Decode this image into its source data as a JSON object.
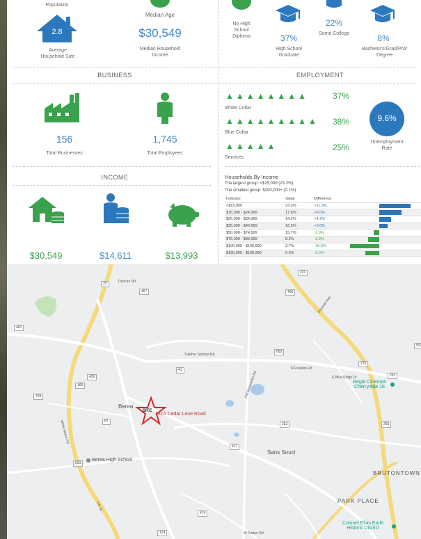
{
  "demographics": {
    "population_label": "Population",
    "avg_household_size_value": "2.8",
    "avg_household_size_label": "Average\nHousehold Size",
    "median_age_label": "Median Age",
    "median_household_income_value": "$30,549",
    "median_household_income_label": "Median Household\nIncome",
    "no_high_school_label": "No High\nSchool\nDiploma",
    "high_school_pct": "37%",
    "high_school_label": "High School\nGraduate",
    "some_college_pct": "22%",
    "some_college_label": "Some College",
    "bachelors_pct": "8%",
    "bachelors_label": "Bachelor's/Grad/Prof\nDegree"
  },
  "business": {
    "title": "BUSINESS",
    "total_businesses_value": "156",
    "total_businesses_label": "Total Businesses",
    "total_employees_value": "1,745",
    "total_employees_label": "Total Employees"
  },
  "employment": {
    "title": "EMPLOYMENT",
    "white_collar_pct": "37%",
    "white_collar_label": "White Collar",
    "blue_collar_pct": "38%",
    "blue_collar_label": "Blue Collar",
    "services_pct": "25%",
    "services_label": "Services",
    "unemployment_value": "9.6%",
    "unemployment_label": "Unemployment\nRate"
  },
  "income": {
    "title": "INCOME",
    "median_household_income": "$30,549",
    "per_capita_income": "$14,611",
    "median_net_worth": "$13,993"
  },
  "households_by_income": {
    "title": "Households By Income",
    "largest_group": "The largest group: <$15,000 (23.3%)",
    "smallest_group": "The smallest group: $200,000+ (0.1%)",
    "headers": [
      "Indicator",
      "Value",
      "Difference"
    ],
    "rows": [
      {
        "indicator": "<$15,000",
        "value": "23.3%",
        "difference": "+11.3%",
        "diff": 11.3
      },
      {
        "indicator": "$15,000 - $24,999",
        "value": "17.8%",
        "difference": "+8.0%",
        "diff": 8.0
      },
      {
        "indicator": "$25,000 - $34,999",
        "value": "14.2%",
        "difference": "+4.2%",
        "diff": 4.2
      },
      {
        "indicator": "$35,000 - $49,999",
        "value": "16.5%",
        "difference": "+3.0%",
        "diff": 3.0
      },
      {
        "indicator": "$50,000 - $74,999",
        "value": "15.7%",
        "difference": "-2.0%",
        "diff": -2.0
      },
      {
        "indicator": "$75,000 - $99,999",
        "value": "8.2%",
        "difference": "-3.9%",
        "diff": -3.9
      },
      {
        "indicator": "$100,000 - $149,999",
        "value": "3.7%",
        "difference": "-10.5%",
        "diff": -10.5
      },
      {
        "indicator": "$150,000 - $199,999",
        "value": "0.5%",
        "difference": "-5.0%",
        "diff": -5.0
      }
    ]
  },
  "map": {
    "site_marker": "SITE",
    "site_address": "1816 Cedar Lane Road",
    "places": [
      "Berea",
      "Sans Souci",
      "BRUTONTOWN",
      "PARK PLACE",
      "Berea High School",
      "Regal Cinemas\nCherrydale 16",
      "Colonel Elias Earle\nHistoric District"
    ],
    "roads": [
      "Duncan Rd",
      "Sulphur Springs Rd",
      "Old Buncombe Rd",
      "N Franklin Rd",
      "E Blue Ridge Dr",
      "White Horse Rd",
      "W Parker Rd",
      "Poinsett Hwy",
      "Lily St"
    ],
    "shields": [
      "25",
      "467",
      "321",
      "466",
      "253",
      "462",
      "430",
      "183",
      "799",
      "87",
      "593",
      "41",
      "682",
      "417",
      "597",
      "276",
      "291",
      "266",
      "474",
      "124",
      "20",
      "291"
    ],
    "colors": {
      "accent_green": "#3aa14c",
      "accent_blue": "#3d88c6",
      "site_red": "#d12a2a"
    }
  }
}
